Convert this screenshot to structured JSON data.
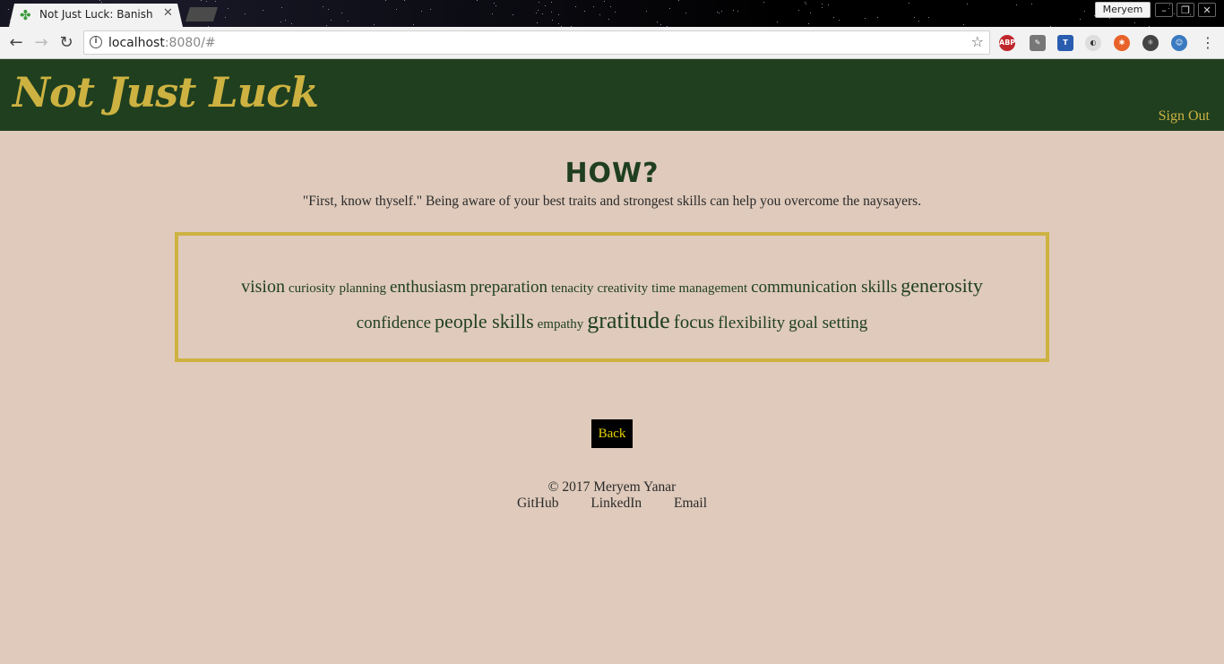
{
  "browser": {
    "tab_title": "Not Just Luck: Banish Im",
    "profile_name": "Meryem",
    "url_host": "localhost",
    "url_rest": ":8080/#",
    "extensions": [
      "ABP"
    ]
  },
  "header": {
    "logo": "Not Just Luck",
    "sign_out": "Sign Out"
  },
  "main": {
    "title": "HOW?",
    "subtitle": "\"First, know thyself.\" Being aware of your best traits and strongest skills can help you overcome the naysayers.",
    "skills": [
      {
        "text": "vision",
        "size": 20
      },
      {
        "text": "curiosity",
        "size": 15
      },
      {
        "text": "planning",
        "size": 15
      },
      {
        "text": "enthusiasm",
        "size": 19
      },
      {
        "text": "preparation",
        "size": 19
      },
      {
        "text": "tenacity",
        "size": 15
      },
      {
        "text": "creativity",
        "size": 15
      },
      {
        "text": "time management",
        "size": 15
      },
      {
        "text": "communication skills",
        "size": 19
      },
      {
        "text": "generosity",
        "size": 22
      },
      {
        "text": "confidence",
        "size": 19
      },
      {
        "text": "people skills",
        "size": 22
      },
      {
        "text": "empathy",
        "size": 15
      },
      {
        "text": "gratitude",
        "size": 26
      },
      {
        "text": "focus",
        "size": 21
      },
      {
        "text": "flexibility",
        "size": 19
      },
      {
        "text": "goal setting",
        "size": 19
      }
    ],
    "back_label": "Back"
  },
  "footer": {
    "copyright": "© 2017 Meryem Yanar",
    "links": [
      "GitHub",
      "LinkedIn",
      "Email"
    ]
  },
  "colors": {
    "header_bg": "#1f3f1f",
    "accent_gold": "#cdb241",
    "page_bg": "#dfcabb",
    "text_green": "#1f3f1f"
  }
}
